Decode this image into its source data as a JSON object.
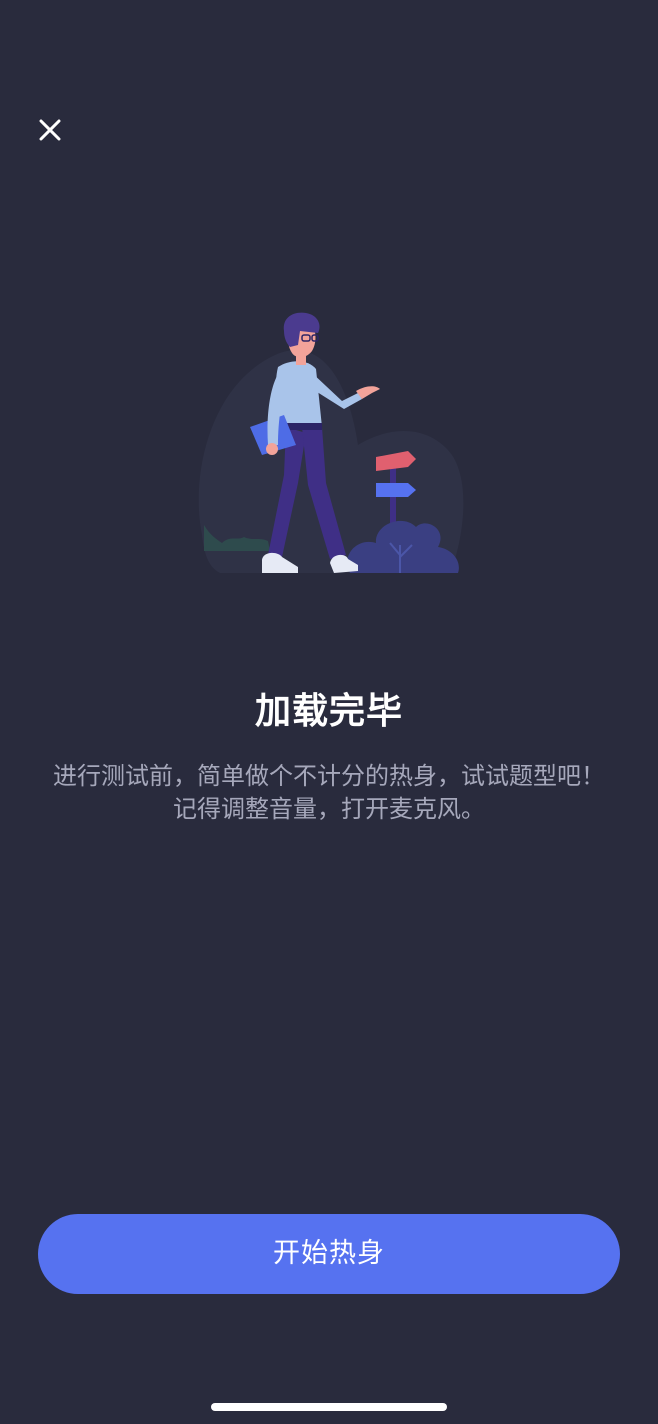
{
  "header": {
    "close_icon": "close-icon"
  },
  "illustration": {
    "icon": "walking-man-signpost-illustration",
    "colors": {
      "blob": "#2f3246",
      "shirt": "#a9c4ea",
      "pants": "#3f2f86",
      "hair": "#4b3b8f",
      "skin": "#f2a39a",
      "book": "#4e6ce6",
      "sign_top": "#e0606f",
      "sign_bottom": "#5672f0",
      "bush": "#3a3f82",
      "grass": "#2e4b4d"
    }
  },
  "main": {
    "title": "加载完毕",
    "description": "进行测试前，简单做个不计分的热身，试试题型吧！记得调整音量，打开麦克风。"
  },
  "actions": {
    "start_label": "开始热身"
  },
  "colors": {
    "background": "#292b3d",
    "accent": "#5672f0",
    "title_text": "#ffffff",
    "description_text": "#a6a8bb"
  }
}
